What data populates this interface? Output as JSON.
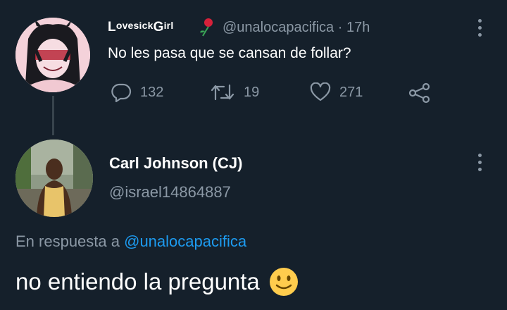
{
  "tweet1": {
    "display_name": "LovesickGirl",
    "name_parts": [
      "L",
      "ovesick",
      "G",
      "irl"
    ],
    "handle": "@unalocapacifica",
    "separator": "·",
    "time": "17h",
    "text": "No les pasa que se cansan de follar?",
    "stats": {
      "replies": "132",
      "retweets": "19",
      "likes": "271"
    }
  },
  "tweet2": {
    "display_name": "Carl Johnson (CJ)",
    "handle": "@israel14864887",
    "reply_prefix": "En respuesta a",
    "reply_to": "@unalocapacifica",
    "text": "no entiendo la pregunta",
    "emoji": "🙂"
  },
  "colors": {
    "background": "#15202b",
    "secondary_text": "#8b98a5",
    "link": "#1d9bf0",
    "thread_line": "#38444d"
  },
  "icons": [
    "reply-icon",
    "retweet-icon",
    "like-icon",
    "share-icon",
    "more-icon",
    "rose-emoji-icon",
    "smile-emoji-icon"
  ]
}
